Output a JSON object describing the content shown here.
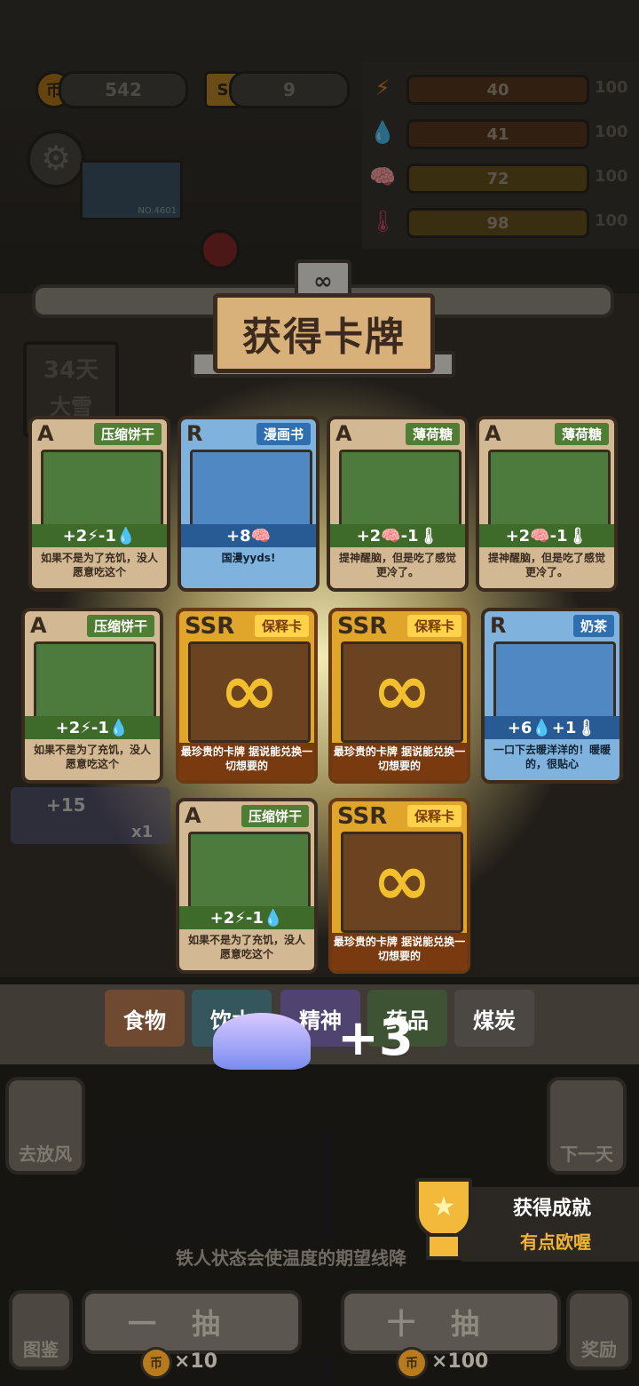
{
  "top": {
    "coins": "542",
    "cards_count": "9",
    "coin_symbol": "币",
    "s_symbol": "S",
    "device_label": "NO.4601"
  },
  "stats": [
    {
      "icon": "lightning-icon",
      "glyph": "⚡",
      "value": "40",
      "max": "100",
      "color": "#e08a2a"
    },
    {
      "icon": "water-drop-icon",
      "glyph": "💧",
      "value": "41",
      "max": "100",
      "color": "#4b8bd0"
    },
    {
      "icon": "brain-icon",
      "glyph": "🧠",
      "value": "72",
      "max": "100",
      "color": "#9e6fd6"
    },
    {
      "icon": "thermometer-icon",
      "glyph": "🌡",
      "value": "98",
      "max": "100",
      "color": "#d6486d"
    }
  ],
  "day": {
    "label": "34天",
    "weather": "大雪"
  },
  "banner": {
    "title": "获得卡牌"
  },
  "cards": [
    {
      "rank": "A",
      "name": "压缩饼干",
      "stats": "+2⚡-1💧",
      "desc": "如果不是为了充饥，没人愿意吃这个",
      "type": "a"
    },
    {
      "rank": "R",
      "name": "漫画书",
      "stats": "+8🧠",
      "desc": "国漫yyds!",
      "type": "r"
    },
    {
      "rank": "A",
      "name": "薄荷糖",
      "stats": "+2🧠-1🌡",
      "desc": "提神醒脑，但是吃了感觉更冷了。",
      "type": "a"
    },
    {
      "rank": "A",
      "name": "薄荷糖",
      "stats": "+2🧠-1🌡",
      "desc": "提神醒脑，但是吃了感觉更冷了。",
      "type": "a"
    },
    {
      "rank": "A",
      "name": "压缩饼干",
      "stats": "+2⚡-1💧",
      "desc": "如果不是为了充饥，没人愿意吃这个",
      "type": "a"
    },
    {
      "rank": "SSR",
      "name": "保释卡",
      "stats": "",
      "desc": "最珍贵的卡牌 据说能兑换一切想要的",
      "type": "ssr"
    },
    {
      "rank": "SSR",
      "name": "保释卡",
      "stats": "",
      "desc": "最珍贵的卡牌 据说能兑换一切想要的",
      "type": "ssr"
    },
    {
      "rank": "R",
      "name": "奶茶",
      "stats": "+6💧+1🌡",
      "desc": "一口下去暖洋洋的！暖暖的，很贴心",
      "type": "r"
    },
    {
      "rank": "A",
      "name": "压缩饼干",
      "stats": "+2⚡-1💧",
      "desc": "如果不是为了充饥，没人愿意吃这个",
      "type": "a"
    },
    {
      "rank": "SSR",
      "name": "保释卡",
      "stats": "",
      "desc": "最珍贵的卡牌 据说能兑换一切想要的",
      "type": "ssr"
    }
  ],
  "reward": {
    "amount": "+3",
    "faded_text": "+15",
    "faded_multiplier": "x1"
  },
  "categories": [
    {
      "label": "食物",
      "color": "#b0613a"
    },
    {
      "label": "饮水",
      "color": "#3d7e8e"
    },
    {
      "label": "精神",
      "color": "#7259a6"
    },
    {
      "label": "药品",
      "color": "#4e7a3a"
    },
    {
      "label": "煤炭",
      "color": "#5f5a53"
    }
  ],
  "side": {
    "left_label": "去放风",
    "right_label": "下一天"
  },
  "hint_text": "铁人状态会使温度的期望线降",
  "achievement": {
    "title": "获得成就",
    "name": "有点欧喔"
  },
  "draw": {
    "one_label": "一抽",
    "ten_label": "十抽",
    "one_cost": "×10",
    "ten_cost": "×100",
    "guide_label": "图鉴",
    "reward_label": "奖励"
  }
}
